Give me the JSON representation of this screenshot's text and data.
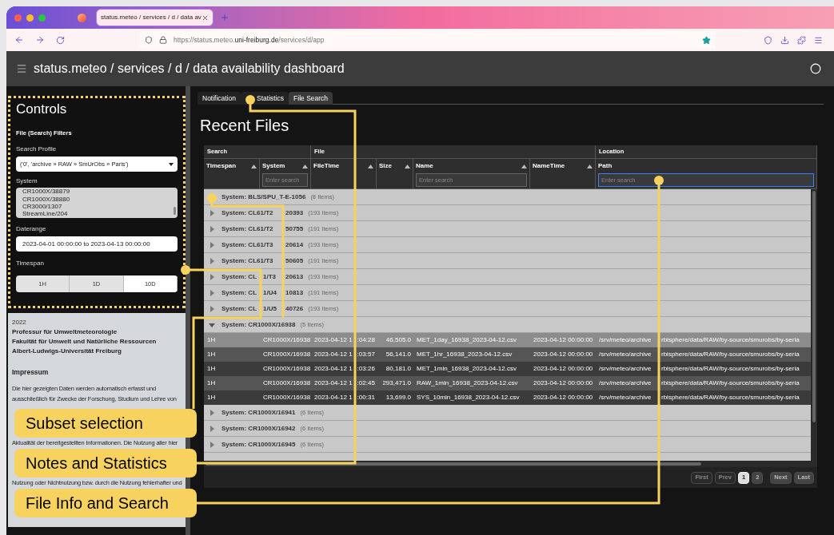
{
  "browser": {
    "tab_title": "status.meteo / services / d / data av",
    "url": {
      "prefix": "https://status.meteo.",
      "domain": "uni-freiburg.de",
      "path": "/services/d/app"
    }
  },
  "app_title": "status.meteo / services / d / data availability dashboard",
  "controls": {
    "heading": "Controls",
    "section": "File (Search) Filters",
    "search_profile": {
      "label": "Search Profile",
      "value": "('0', 'archive » RAW » SmUrObs » Paris')"
    },
    "system": {
      "label": "System",
      "options": [
        "CR1000X/38879",
        "CR1000X/38880",
        "CR3000/1307",
        "StreamLine/204"
      ]
    },
    "daterange": {
      "label": "Daterange",
      "value": "2023-04-01 00:00:00 to 2023-04-13 00:00:00"
    },
    "timespan": {
      "label": "Timespan",
      "options": [
        {
          "label": "1H",
          "selected": false
        },
        {
          "label": "1D",
          "selected": false
        },
        {
          "label": "10D",
          "selected": true
        }
      ]
    }
  },
  "footer": {
    "year": "2022",
    "institution": [
      "Professur für Umweltmeteorologie",
      "Fakultät für Umwelt und Natürliche Ressourcen",
      "Albert-Ludwigs-Universität Freiburg"
    ],
    "heading": "Impressum",
    "lines": [
      "Die hier gezeigten Daten werden automatisch erfasst und",
      "ausschließlich für Zwecke der Forschung, Studium und Lehre von",
      "Aktualität der bereitgestellten Informationen. Die Nutzung aller hier",
      "Nutzung oder Nichtnutzung bzw. durch die Nutzung fehlerhafter und"
    ]
  },
  "tabs": [
    {
      "label": "Notification",
      "selected": false
    },
    {
      "label": "Statistics",
      "selected": false
    },
    {
      "label": "File Search",
      "selected": true
    }
  ],
  "heading": "Recent Files",
  "table": {
    "column_groups": [
      {
        "label": "Search",
        "columns": [
          {
            "label": "Timespan",
            "sortable": true
          },
          {
            "label": "System",
            "sortable": true,
            "placeholder": "Enter search",
            "focused": false
          }
        ]
      },
      {
        "label": "File",
        "columns": [
          {
            "label": "FileTime",
            "sortable": true
          },
          {
            "label": "Size",
            "sortable": true
          },
          {
            "label": "Name",
            "sortable": true,
            "placeholder": "Enter search",
            "focused": false
          },
          {
            "label": "NameTime",
            "sortable": true
          }
        ]
      },
      {
        "label": "Location",
        "columns": [
          {
            "label": "Path",
            "sortable": false,
            "placeholder": "Enter search",
            "focused": true
          }
        ]
      }
    ],
    "groups": [
      {
        "label_parts": [
          "System: BLS/SPU_T-E-1056"
        ],
        "count": "(8 Items)"
      },
      {
        "label_parts": [
          "System: CL61/T2",
          "20393"
        ],
        "count": "(193 Items)",
        "expanded": false
      },
      {
        "label_parts": [
          "System: CL61/T2",
          "50755"
        ],
        "count": "(191 Items)",
        "expanded": false
      },
      {
        "label_parts": [
          "System: CL61/T3",
          "20614"
        ],
        "count": "(193 Items)",
        "expanded": false
      },
      {
        "label_parts": [
          "System: CL61/T3",
          "50605"
        ],
        "count": "(191 Items)",
        "expanded": false
      },
      {
        "label_parts": [
          "System: CL",
          "1/T3",
          "20613"
        ],
        "count": "(193 Items)",
        "expanded": false
      },
      {
        "label_parts": [
          "System: CL",
          "1/U4",
          "10813"
        ],
        "count": "(191 Items)",
        "expanded": false
      },
      {
        "label_parts": [
          "System: CL",
          "1/U5",
          "40726"
        ],
        "count": "(193 Items)",
        "expanded": false
      },
      {
        "label_parts": [
          "System: CR1000X/16938"
        ],
        "count": "(5 Items)",
        "expanded": true,
        "files": [
          {
            "timespan": "1H",
            "system": "CR1000X/16938",
            "filetime_parts": [
              "2023-04-12 1",
              ":04:28"
            ],
            "size": "46,505.0",
            "name": "MET_1day_16938_2023-04-12.csv",
            "nametime": "2023-04-12 00:00:00",
            "path_parts": [
              "/srv/meteo/archive",
              "rbisphere/data/RAW/by-source/smurobs/by-seria"
            ],
            "selected": true
          },
          {
            "timespan": "1H",
            "system": "CR1000X/16938",
            "filetime_parts": [
              "2023-04-12 1",
              ":03:57"
            ],
            "size": "56,141.0",
            "name": "MET_1hr_16938_2023-04-12.csv",
            "nametime": "2023-04-12 00:00:00",
            "path_parts": [
              "/srv/meteo/archive",
              "rbisphere/data/RAW/by-source/smurobs/by-seria"
            ],
            "selected": false
          },
          {
            "timespan": "1H",
            "system": "CR1000X/16938",
            "filetime_parts": [
              "2023-04-12 1",
              ":03:26"
            ],
            "size": "80,181.0",
            "name": "MET_1min_16938_2023-04-12.csv",
            "nametime": "2023-04-12 00:00:00",
            "path_parts": [
              "/srv/meteo/archive",
              "rbisphere/data/RAW/by-source/smurobs/by-seria"
            ],
            "selected": false
          },
          {
            "timespan": "1H",
            "system": "CR1000X/16938",
            "filetime_parts": [
              "2023-04-12 1",
              ":02:45"
            ],
            "size": "293,471.0",
            "name": "RAW_1min_16938_2023-04-12.csv",
            "nametime": "2023-04-12 00:00:00",
            "path_parts": [
              "/srv/meteo/archive",
              "rbisphere/data/RAW/by-source/smurobs/by-seria"
            ],
            "selected": false
          },
          {
            "timespan": "1H",
            "system": "CR1000X/16938",
            "filetime_parts": [
              "2023-04-12 1",
              ":00:31"
            ],
            "size": "13,699.0",
            "name": "SYS_10min_16938_2023-04-12.csv",
            "nametime": "2023-04-12 00:00:00",
            "path_parts": [
              "/srv/meteo/archive",
              "rbisphere/data/RAW/by-source/smurobs/by-seria"
            ],
            "selected": false
          }
        ]
      },
      {
        "label_parts": [
          "System: CR1000X/16941"
        ],
        "count": "(6 Items)",
        "expanded": false
      },
      {
        "label_parts": [
          "System: CR1000X/16942"
        ],
        "count": "(6 Items)",
        "expanded": false
      },
      {
        "label_parts": [
          "System: CR1000X/16945"
        ],
        "count": "(6 Items)",
        "expanded": false
      }
    ]
  },
  "pagination": [
    {
      "label": "First",
      "disabled": true,
      "selected": false
    },
    {
      "label": "Prev",
      "disabled": true,
      "selected": false
    },
    {
      "label": "1",
      "disabled": false,
      "selected": true
    },
    {
      "label": "2",
      "disabled": false,
      "selected": false
    },
    {
      "label": "Next",
      "disabled": false,
      "selected": false
    },
    {
      "label": "Last",
      "disabled": false,
      "selected": false
    }
  ],
  "annotations": [
    {
      "text": "Subset selection"
    },
    {
      "text": "Notes and Statistics"
    },
    {
      "text": "File Info and Search"
    }
  ]
}
